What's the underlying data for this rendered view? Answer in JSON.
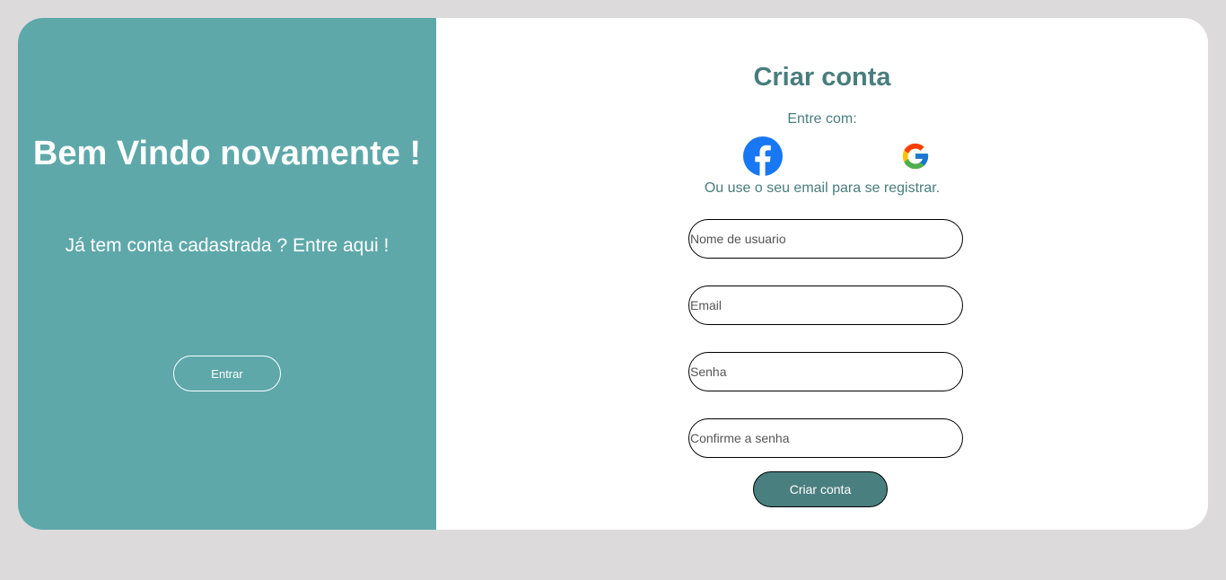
{
  "colors": {
    "page_background": "#dcdadb",
    "left_panel": "#5ea8aa",
    "accent_text": "#497d7d",
    "create_button": "#4a7f7f",
    "facebook_blue": "#1877f2"
  },
  "left_panel": {
    "title": "Bem Vindo novamente !",
    "subtitle": "Já tem conta cadastrada ? Entre aqui !",
    "login_button": "Entrar"
  },
  "signup": {
    "title": "Criar conta",
    "enter_with": "Entre com:",
    "social": [
      {
        "name": "facebook",
        "icon": "facebook-icon"
      },
      {
        "name": "google",
        "icon": "google-icon"
      }
    ],
    "or_email": "Ou use o seu email para se registrar.",
    "fields": {
      "username": {
        "placeholder": "Nome de usuario",
        "value": ""
      },
      "email": {
        "placeholder": "Email",
        "value": ""
      },
      "password": {
        "placeholder": "Senha",
        "value": ""
      },
      "confirm_password": {
        "placeholder": "Confirme a senha",
        "value": ""
      }
    },
    "submit_button": "Criar conta"
  }
}
